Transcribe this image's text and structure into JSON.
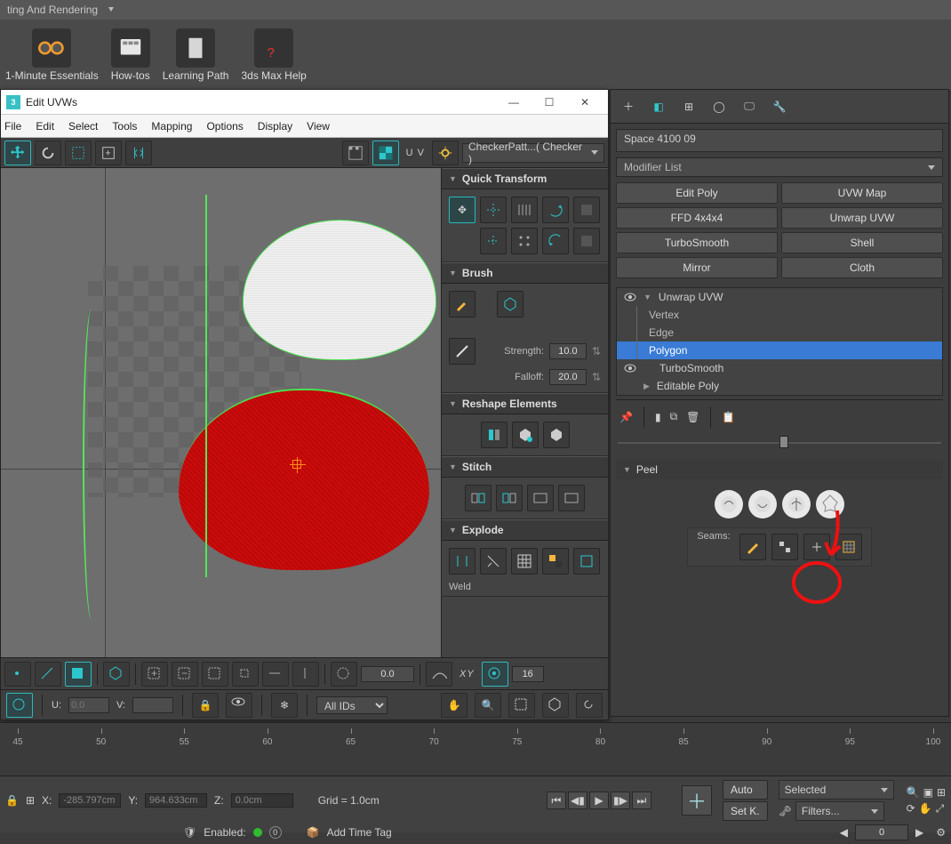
{
  "top": {
    "section_label": "ting And Rendering"
  },
  "shortcuts": [
    {
      "label": "1-Minute Essentials"
    },
    {
      "label": "How-tos"
    },
    {
      "label": "Learning Path"
    },
    {
      "label": "3ds Max Help"
    }
  ],
  "uv_window": {
    "title": "Edit UVWs",
    "menubar": [
      "File",
      "Edit",
      "Select",
      "Tools",
      "Mapping",
      "Options",
      "Display",
      "View"
    ],
    "uv_label": "U V",
    "checker_combo": "CheckerPatt...( Checker )",
    "rollouts": {
      "quick_transform": {
        "title": "Quick Transform"
      },
      "brush": {
        "title": "Brush",
        "strength_label": "Strength:",
        "strength": "10.0",
        "falloff_label": "Falloff:",
        "falloff": "20.0"
      },
      "reshape": {
        "title": "Reshape Elements"
      },
      "stitch": {
        "title": "Stitch"
      },
      "explode": {
        "title": "Explode"
      },
      "weld": {
        "title": "Weld"
      }
    },
    "bottom1": {
      "val": "0.0",
      "xy": "XY",
      "spin": "16"
    },
    "bottom2": {
      "u_label": "U:",
      "u_val": "0.0",
      "v_label": "V:",
      "combo": "All IDs"
    }
  },
  "right_panel": {
    "object_name": "Space 4100 09",
    "modlist_label": "Modifier List",
    "buttons": [
      "Edit Poly",
      "UVW Map",
      "FFD 4x4x4",
      "Unwrap UVW",
      "TurboSmooth",
      "Shell",
      "Mirror",
      "Cloth"
    ],
    "stack": {
      "unwrap": "Unwrap UVW",
      "subs": [
        "Vertex",
        "Edge",
        "Polygon"
      ],
      "turbosmooth": "TurboSmooth",
      "editpoly": "Editable Poly"
    },
    "peel": {
      "title": "Peel",
      "seams_label": "Seams:"
    }
  },
  "timeline": {
    "ticks": [
      45,
      50,
      55,
      60,
      65,
      70,
      75,
      80,
      85,
      90,
      95,
      100
    ]
  },
  "status": {
    "x_label": "X:",
    "x_val": "-285.797cm",
    "y_label": "Y:",
    "y_val": "964.633cm",
    "z_label": "Z:",
    "z_val": "0.0cm",
    "grid": "Grid = 1.0cm",
    "enabled_label": "Enabled:",
    "addtag": "Add Time Tag",
    "auto": "Auto",
    "setk": "Set K.",
    "selected": "Selected",
    "filters": "Filters...",
    "frame": "0"
  }
}
